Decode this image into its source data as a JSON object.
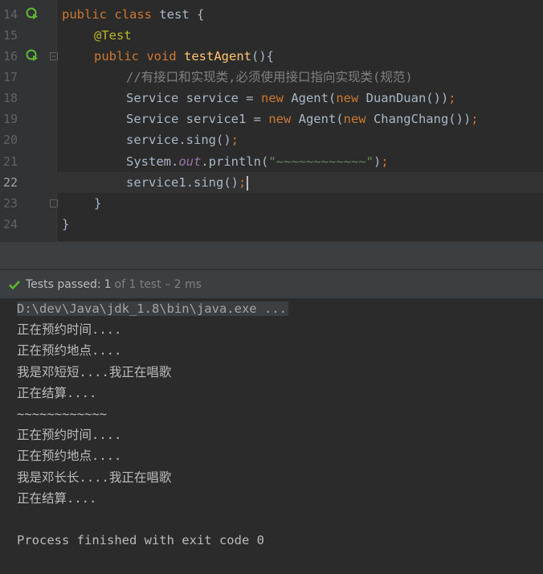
{
  "editor": {
    "line_numbers": [
      "14",
      "15",
      "16",
      "17",
      "18",
      "19",
      "20",
      "21",
      "22",
      "23",
      "24"
    ],
    "current_line": "22",
    "code": {
      "l14_kw1": "public",
      "l14_kw2": "class",
      "l14_rest": " test {",
      "l15_ann": "@Test",
      "l16_kw1": "public",
      "l16_kw2": "void",
      "l16_fn": "testAgent",
      "l16_rest": "(){",
      "l17_comment": "//有接口和实现类,必须使用接口指向实现类(规范)",
      "l18_a": "Service service = ",
      "l18_kw1": "new",
      "l18_b": " Agent(",
      "l18_kw2": "new",
      "l18_c": " DuanDuan())",
      "l18_semi": ";",
      "l19_a": "Service service1 = ",
      "l19_kw1": "new",
      "l19_b": " Agent(",
      "l19_kw2": "new",
      "l19_c": " ChangChang())",
      "l19_semi": ";",
      "l20_a": "service.sing()",
      "l20_semi": ";",
      "l21_a": "System.",
      "l21_static": "out",
      "l21_b": ".println(",
      "l21_str": "\"~~~~~~~~~~~~\"",
      "l21_c": ")",
      "l21_semi": ";",
      "l22_a": "service1.sing()",
      "l22_semi": ";",
      "l23": "}",
      "l24": "}"
    }
  },
  "status": {
    "text": "Tests passed:",
    "count": "1",
    "rest": "of 1 test – 2 ms"
  },
  "console": {
    "command": "D:\\dev\\Java\\jdk_1.8\\bin\\java.exe ...",
    "lines": [
      "正在预约时间....",
      "正在预约地点....",
      "我是邓短短....我正在唱歌",
      "正在结算....",
      "~~~~~~~~~~~~",
      "正在预约时间....",
      "正在预约地点....",
      "我是邓长长....我正在唱歌",
      "正在结算....",
      "Process finished with exit code 0"
    ]
  },
  "colors": {
    "editor_bg": "#2b2b2b",
    "keyword": "#cc7832",
    "annotation": "#bbb529",
    "function": "#ffc66d",
    "comment": "#808080",
    "string": "#6a8759",
    "success": "#5fb832"
  },
  "icons": {
    "run": "run-test-icon",
    "fold": "fold-icon",
    "check": "check-icon"
  }
}
